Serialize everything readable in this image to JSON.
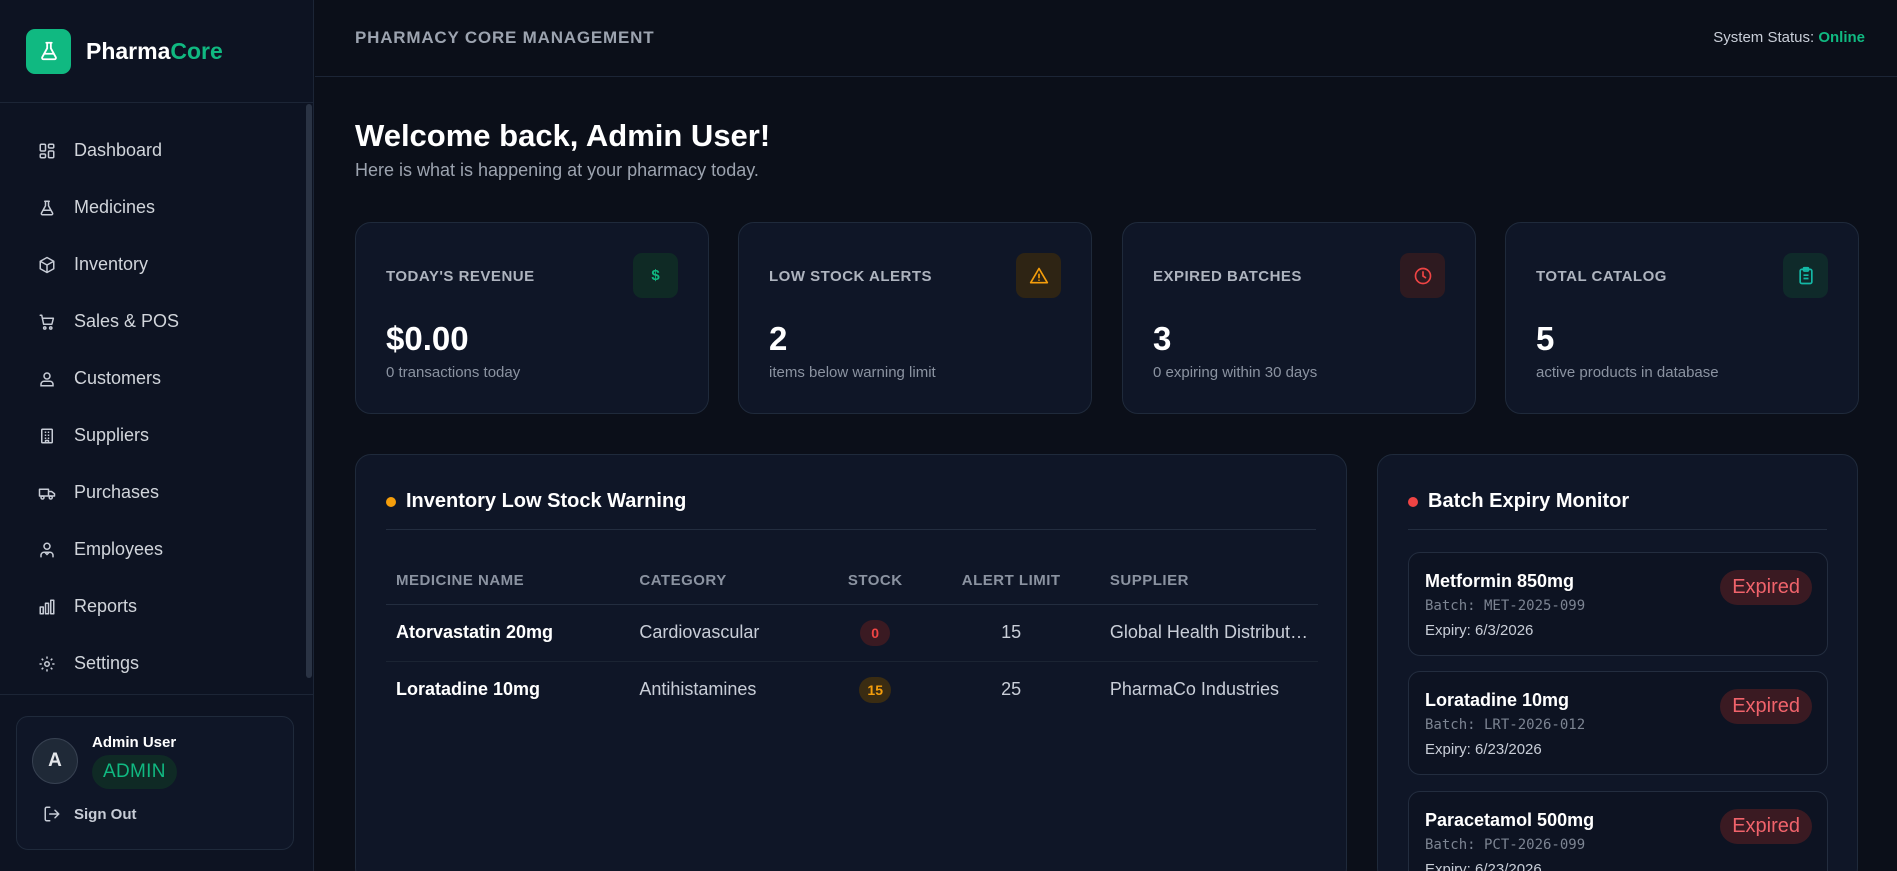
{
  "brand": {
    "name_part1": "Pharma",
    "name_part2": "Core"
  },
  "sidebar": {
    "items": [
      {
        "label": "Dashboard",
        "icon": "grid-icon"
      },
      {
        "label": "Medicines",
        "icon": "flask-icon"
      },
      {
        "label": "Inventory",
        "icon": "box-icon"
      },
      {
        "label": "Sales & POS",
        "icon": "cart-icon"
      },
      {
        "label": "Customers",
        "icon": "users-icon"
      },
      {
        "label": "Suppliers",
        "icon": "building-icon"
      },
      {
        "label": "Purchases",
        "icon": "truck-icon"
      },
      {
        "label": "Employees",
        "icon": "employees-icon"
      },
      {
        "label": "Reports",
        "icon": "bar-chart-icon"
      },
      {
        "label": "Settings",
        "icon": "gear-icon"
      }
    ],
    "user": {
      "initial": "A",
      "name": "Admin User",
      "role": "ADMIN"
    },
    "signout_label": "Sign Out"
  },
  "header": {
    "title": "PHARMACY CORE MANAGEMENT",
    "status_label": "System Status:",
    "status_value": "Online"
  },
  "welcome": {
    "title": "Welcome back, Admin User!",
    "subtitle": "Here is what is happening at your pharmacy today."
  },
  "stats": [
    {
      "label": "TODAY'S REVENUE",
      "value": "$0.00",
      "sub": "0 transactions today",
      "icon": "dollar-icon",
      "icon_symbol": "$",
      "color": "#10b981"
    },
    {
      "label": "LOW STOCK ALERTS",
      "value": "2",
      "sub": "items below warning limit",
      "icon": "warning-icon",
      "color": "#f59e0b"
    },
    {
      "label": "EXPIRED BATCHES",
      "value": "3",
      "sub": "0 expiring within 30 days",
      "icon": "clock-icon",
      "color": "#ef4444"
    },
    {
      "label": "TOTAL CATALOG",
      "value": "5",
      "sub": "active products in database",
      "icon": "clipboard-icon",
      "color": "#14b8a6"
    }
  ],
  "low_stock": {
    "title": "Inventory Low Stock Warning",
    "columns": [
      "MEDICINE NAME",
      "CATEGORY",
      "STOCK",
      "ALERT LIMIT",
      "SUPPLIER"
    ],
    "rows": [
      {
        "name": "Atorvastatin 20mg",
        "category": "Cardiovascular",
        "stock": "0",
        "alert_limit": "15",
        "supplier": "Global Health Distribut…"
      },
      {
        "name": "Loratadine 10mg",
        "category": "Antihistamines",
        "stock": "15",
        "alert_limit": "25",
        "supplier": "PharmaCo Industries"
      }
    ]
  },
  "expiry": {
    "title": "Batch Expiry Monitor",
    "batches": [
      {
        "name": "Metformin 850mg",
        "batch": "Batch: MET-2025-099",
        "expiry": "Expiry: 6/3/2026",
        "status": "Expired"
      },
      {
        "name": "Loratadine 10mg",
        "batch": "Batch: LRT-2026-012",
        "expiry": "Expiry: 6/23/2026",
        "status": "Expired"
      },
      {
        "name": "Paracetamol 500mg",
        "batch": "Batch: PCT-2026-099",
        "expiry": "Expiry: 6/23/2026",
        "status": "Expired"
      }
    ]
  },
  "colors": {
    "accent": "#10b981",
    "warning": "#f59e0b",
    "danger": "#ef4444",
    "background": "#0b0f19",
    "card": "#0f1627"
  }
}
